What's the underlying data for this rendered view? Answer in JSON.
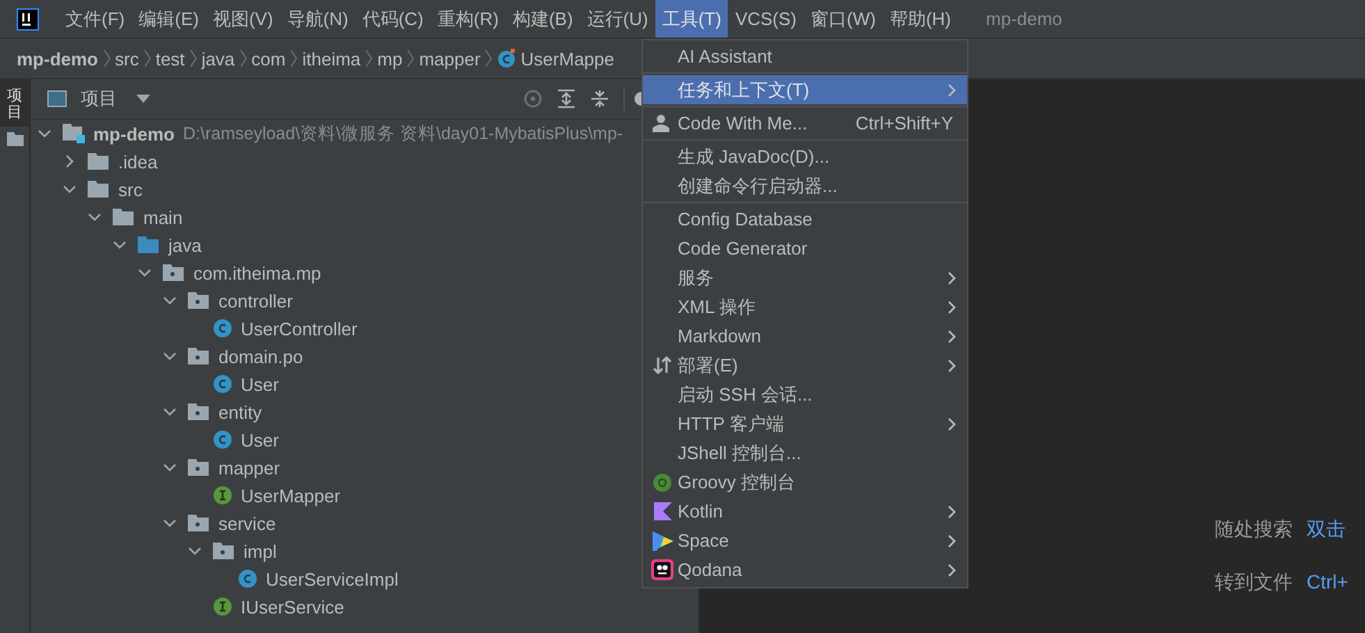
{
  "menubar": [
    {
      "label": "文件(F)",
      "selected": false
    },
    {
      "label": "编辑(E)",
      "selected": false
    },
    {
      "label": "视图(V)",
      "selected": false
    },
    {
      "label": "导航(N)",
      "selected": false
    },
    {
      "label": "代码(C)",
      "selected": false
    },
    {
      "label": "重构(R)",
      "selected": false
    },
    {
      "label": "构建(B)",
      "selected": false
    },
    {
      "label": "运行(U)",
      "selected": false
    },
    {
      "label": "工具(T)",
      "selected": true
    },
    {
      "label": "VCS(S)",
      "selected": false
    },
    {
      "label": "窗口(W)",
      "selected": false
    },
    {
      "label": "帮助(H)",
      "selected": false
    }
  ],
  "window": {
    "title": "mp-demo"
  },
  "breadcrumb": [
    {
      "label": "mp-demo",
      "kind": "module"
    },
    {
      "label": "src",
      "kind": "dir"
    },
    {
      "label": "test",
      "kind": "dir"
    },
    {
      "label": "java",
      "kind": "dir"
    },
    {
      "label": "com",
      "kind": "dir"
    },
    {
      "label": "itheima",
      "kind": "dir"
    },
    {
      "label": "mp",
      "kind": "dir"
    },
    {
      "label": "mapper",
      "kind": "dir"
    },
    {
      "label": "UserMappe",
      "kind": "class"
    }
  ],
  "side_tab": {
    "label": "项目",
    "selected": true
  },
  "project_panel": {
    "title": "项目"
  },
  "tree": [
    {
      "label": "mp-demo",
      "path": "D:\\ramseyload\\资料\\微服务 资料\\day01-MybatisPlus\\mp-",
      "kind": "module",
      "expanded": true,
      "children": [
        {
          "label": ".idea",
          "kind": "folder",
          "expanded": false
        },
        {
          "label": "src",
          "kind": "folder",
          "expanded": true,
          "children": [
            {
              "label": "main",
              "kind": "folder",
              "expanded": true,
              "children": [
                {
                  "label": "java",
                  "kind": "source",
                  "expanded": true,
                  "children": [
                    {
                      "label": "com.itheima.mp",
                      "kind": "package",
                      "expanded": true,
                      "children": [
                        {
                          "label": "controller",
                          "kind": "package",
                          "expanded": true,
                          "children": [
                            {
                              "label": "UserController",
                              "kind": "class"
                            }
                          ]
                        },
                        {
                          "label": "domain.po",
                          "kind": "package",
                          "expanded": true,
                          "children": [
                            {
                              "label": "User",
                              "kind": "class"
                            }
                          ]
                        },
                        {
                          "label": "entity",
                          "kind": "package",
                          "expanded": true,
                          "children": [
                            {
                              "label": "User",
                              "kind": "class"
                            }
                          ]
                        },
                        {
                          "label": "mapper",
                          "kind": "package",
                          "expanded": true,
                          "children": [
                            {
                              "label": "UserMapper",
                              "kind": "interface"
                            }
                          ]
                        },
                        {
                          "label": "service",
                          "kind": "package",
                          "expanded": true,
                          "children": [
                            {
                              "label": "impl",
                              "kind": "package",
                              "expanded": true,
                              "children": [
                                {
                                  "label": "UserServiceImpl",
                                  "kind": "class"
                                }
                              ]
                            },
                            {
                              "label": "IUserService",
                              "kind": "interface"
                            }
                          ]
                        }
                      ]
                    }
                  ]
                }
              ]
            }
          ]
        }
      ]
    }
  ],
  "menu": [
    {
      "kind": "item",
      "label": "AI Assistant",
      "selected": false
    },
    {
      "kind": "separator"
    },
    {
      "kind": "item",
      "label": "任务和上下文(T)",
      "submenu": true,
      "selected": true
    },
    {
      "kind": "separator"
    },
    {
      "kind": "item",
      "label": "Code With Me...",
      "shortcut": "Ctrl+Shift+Y",
      "selected": false
    },
    {
      "kind": "separator"
    },
    {
      "kind": "item",
      "label": "生成 JavaDoc(D)...",
      "selected": false
    },
    {
      "kind": "item",
      "label": "创建命令行启动器...",
      "selected": false
    },
    {
      "kind": "separator"
    },
    {
      "kind": "item",
      "label": "Config Database",
      "selected": false
    },
    {
      "kind": "item",
      "label": "Code Generator",
      "selected": false
    },
    {
      "kind": "item",
      "label": "服务",
      "submenu": true,
      "selected": false
    },
    {
      "kind": "item",
      "label": "XML 操作",
      "submenu": true,
      "selected": false
    },
    {
      "kind": "item",
      "label": "Markdown",
      "submenu": true,
      "selected": false
    },
    {
      "kind": "item",
      "label": "部署(E)",
      "submenu": true,
      "selected": false
    },
    {
      "kind": "item",
      "label": "启动 SSH 会话...",
      "selected": false
    },
    {
      "kind": "item",
      "label": "HTTP 客户端",
      "submenu": true,
      "selected": false
    },
    {
      "kind": "item",
      "label": "JShell 控制台...",
      "selected": false
    },
    {
      "kind": "item",
      "label": "Groovy 控制台",
      "selected": false
    },
    {
      "kind": "item",
      "label": "Kotlin",
      "submenu": true,
      "selected": false
    },
    {
      "kind": "item",
      "label": "Space",
      "submenu": true,
      "selected": false
    },
    {
      "kind": "item",
      "label": "Qodana",
      "submenu": true,
      "selected": false
    }
  ],
  "hints": [
    {
      "label": "随处搜索",
      "shortcut": "双击"
    },
    {
      "label": "转到文件",
      "shortcut": "Ctrl+"
    }
  ]
}
